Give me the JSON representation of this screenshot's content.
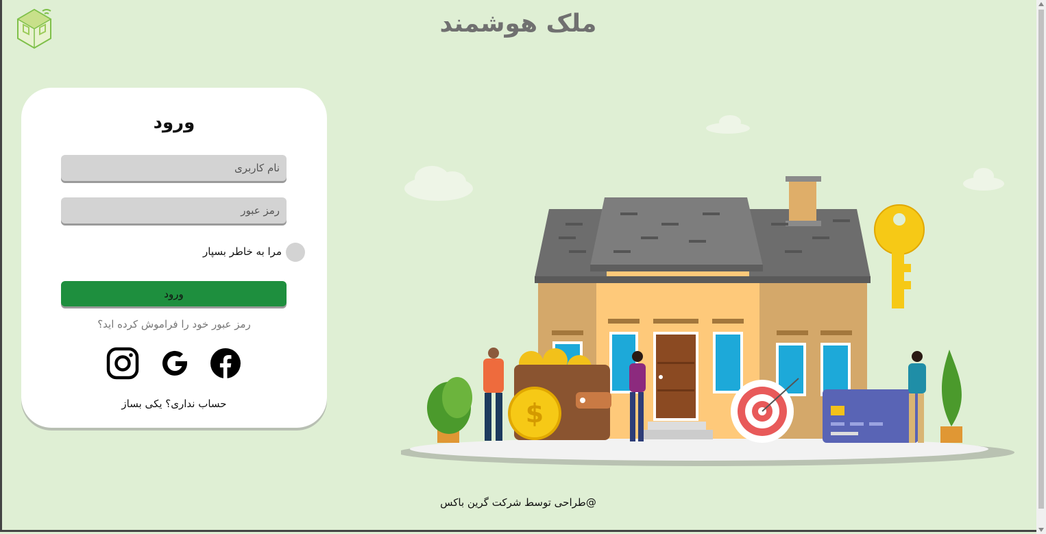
{
  "header": {
    "title": "ملک هوشمند"
  },
  "login": {
    "heading": "ورود",
    "username_placeholder": "نام کاربری",
    "password_placeholder": "رمز عبور",
    "remember_label": "مرا به خاطر بسپار",
    "submit_label": "ورود",
    "forgot_link": "رمز عبور خود را فراموش کرده اید؟",
    "signup_link": "حساب نداری؟ یکی بساز",
    "socials": [
      "instagram-icon",
      "google-icon",
      "facebook-icon"
    ]
  },
  "footer": {
    "credit": "@طراحی توسط شرکت گرین باکس"
  },
  "colors": {
    "background": "#dfefd4",
    "primary": "#1e8f3e",
    "card": "#ffffff",
    "field": "#d3d3d3"
  }
}
